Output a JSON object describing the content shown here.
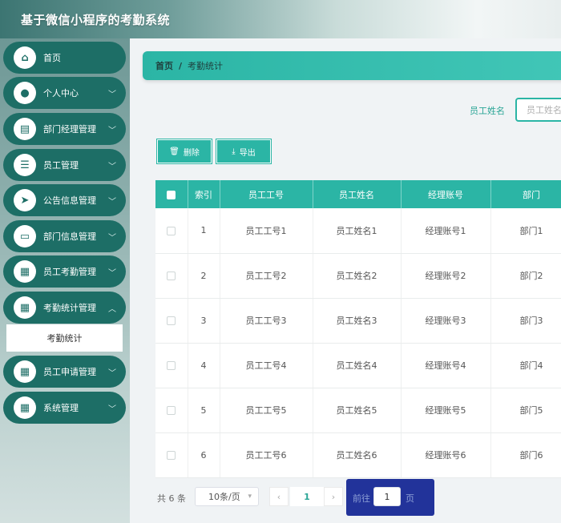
{
  "app": {
    "title": "基于微信小程序的考勤系统"
  },
  "colors": {
    "accent": "#2bb5a5",
    "sidebar_item": "#1d6e66",
    "pager_decor": "#22339a"
  },
  "sidebar": {
    "items": [
      {
        "label": "首页",
        "icon": "home-icon",
        "has_arrow": false
      },
      {
        "label": "个人中心",
        "icon": "user-icon",
        "has_arrow": true
      },
      {
        "label": "部门经理管理",
        "icon": "clipboard-icon",
        "has_arrow": true
      },
      {
        "label": "员工管理",
        "icon": "list-icon",
        "has_arrow": true
      },
      {
        "label": "公告信息管理",
        "icon": "send-icon",
        "has_arrow": true
      },
      {
        "label": "部门信息管理",
        "icon": "monitor-icon",
        "has_arrow": true
      },
      {
        "label": "员工考勤管理",
        "icon": "grid-icon",
        "has_arrow": true
      },
      {
        "label": "考勤统计管理",
        "icon": "grid-icon",
        "has_arrow": true,
        "expanded": true
      },
      {
        "label": "员工申请管理",
        "icon": "grid-icon",
        "has_arrow": true
      },
      {
        "label": "系统管理",
        "icon": "grid-icon",
        "has_arrow": true
      }
    ],
    "sub_item": {
      "label": "考勤统计",
      "selected": true
    }
  },
  "breadcrumb": {
    "home": "首页",
    "separator": "/",
    "current": "考勤统计"
  },
  "search": {
    "label": "员工姓名",
    "placeholder": "员工姓名"
  },
  "toolbar": {
    "delete_label": "删除",
    "export_label": "导出"
  },
  "table": {
    "columns": [
      "索引",
      "员工工号",
      "员工姓名",
      "经理账号",
      "部门"
    ],
    "rows": [
      [
        "1",
        "员工工号1",
        "员工姓名1",
        "经理账号1",
        "部门1"
      ],
      [
        "2",
        "员工工号2",
        "员工姓名2",
        "经理账号2",
        "部门2"
      ],
      [
        "3",
        "员工工号3",
        "员工姓名3",
        "经理账号3",
        "部门3"
      ],
      [
        "4",
        "员工工号4",
        "员工姓名4",
        "经理账号4",
        "部门4"
      ],
      [
        "5",
        "员工工号5",
        "员工姓名5",
        "经理账号5",
        "部门5"
      ],
      [
        "6",
        "员工工号6",
        "员工姓名6",
        "经理账号6",
        "部门6"
      ]
    ]
  },
  "pagination": {
    "total": "共 6 条",
    "page_size": "10条/页",
    "current_page": "1",
    "goto_label": "前往",
    "goto_value": "1",
    "goto_unit": "页"
  }
}
